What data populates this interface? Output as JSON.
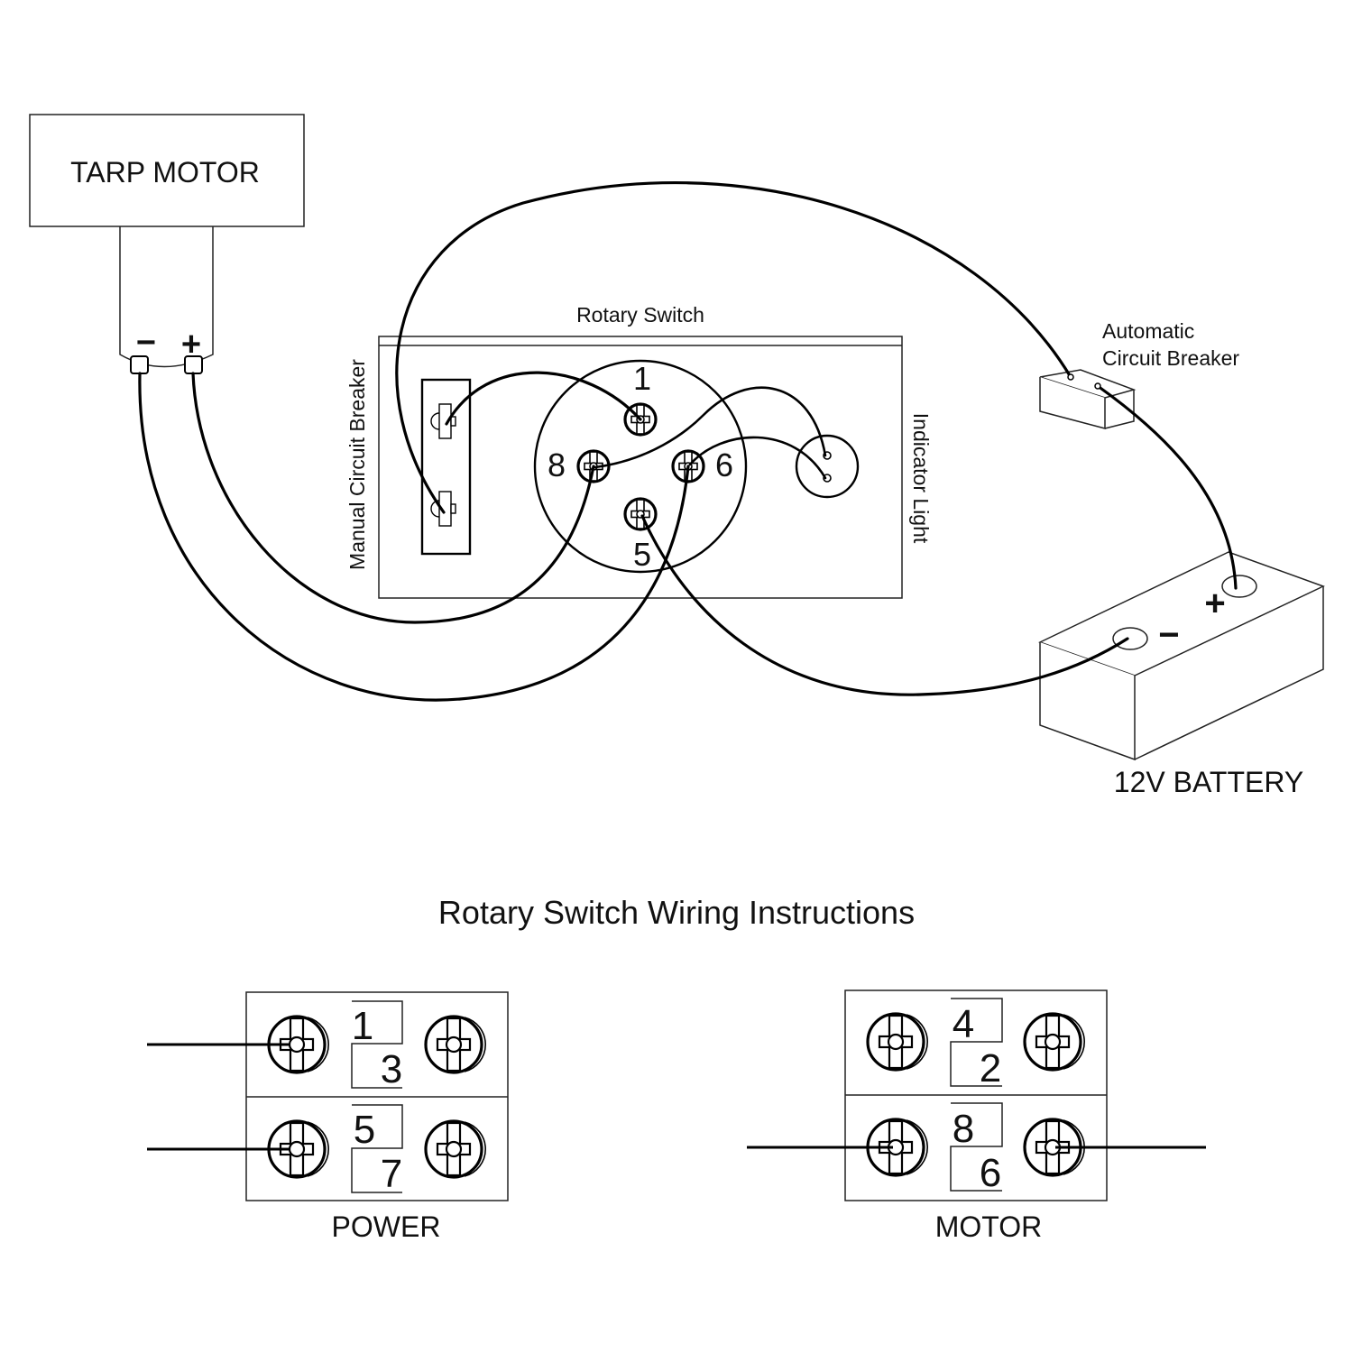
{
  "diagram": {
    "tarp_motor": {
      "label": "TARP MOTOR",
      "negative_symbol": "−",
      "positive_symbol": "+"
    },
    "rotary_switch": {
      "label": "Rotary Switch",
      "manual_breaker_label": "Manual Circuit Breaker",
      "indicator_label": "Indicator Light",
      "terminals": [
        "1",
        "8",
        "6",
        "5"
      ]
    },
    "auto_breaker": {
      "line1": "Automatic",
      "line2": "Circuit Breaker"
    },
    "battery": {
      "label": "12V BATTERY",
      "positive_symbol": "+",
      "negative_symbol": "−"
    },
    "instructions": {
      "title": "Rotary Switch Wiring Instructions",
      "power": {
        "label": "POWER",
        "top": [
          "1",
          "3"
        ],
        "bottom": [
          "5",
          "7"
        ]
      },
      "motor": {
        "label": "MOTOR",
        "top": [
          "4",
          "2"
        ],
        "bottom": [
          "8",
          "6"
        ]
      }
    },
    "connections": [
      {
        "from": "Tarp Motor −",
        "to": "Rotary Switch 6"
      },
      {
        "from": "Tarp Motor +",
        "to": "Rotary Switch 8"
      },
      {
        "from": "Manual Circuit Breaker top",
        "to": "Rotary Switch 1"
      },
      {
        "from": "Manual Circuit Breaker bottom",
        "to": "Automatic Circuit Breaker"
      },
      {
        "from": "Automatic Circuit Breaker",
        "to": "12V Battery +"
      },
      {
        "from": "Rotary Switch 5",
        "to": "12V Battery −"
      },
      {
        "from": "Rotary Switch 8",
        "to": "Indicator Light"
      },
      {
        "from": "Rotary Switch 6",
        "to": "Indicator Light"
      }
    ]
  }
}
